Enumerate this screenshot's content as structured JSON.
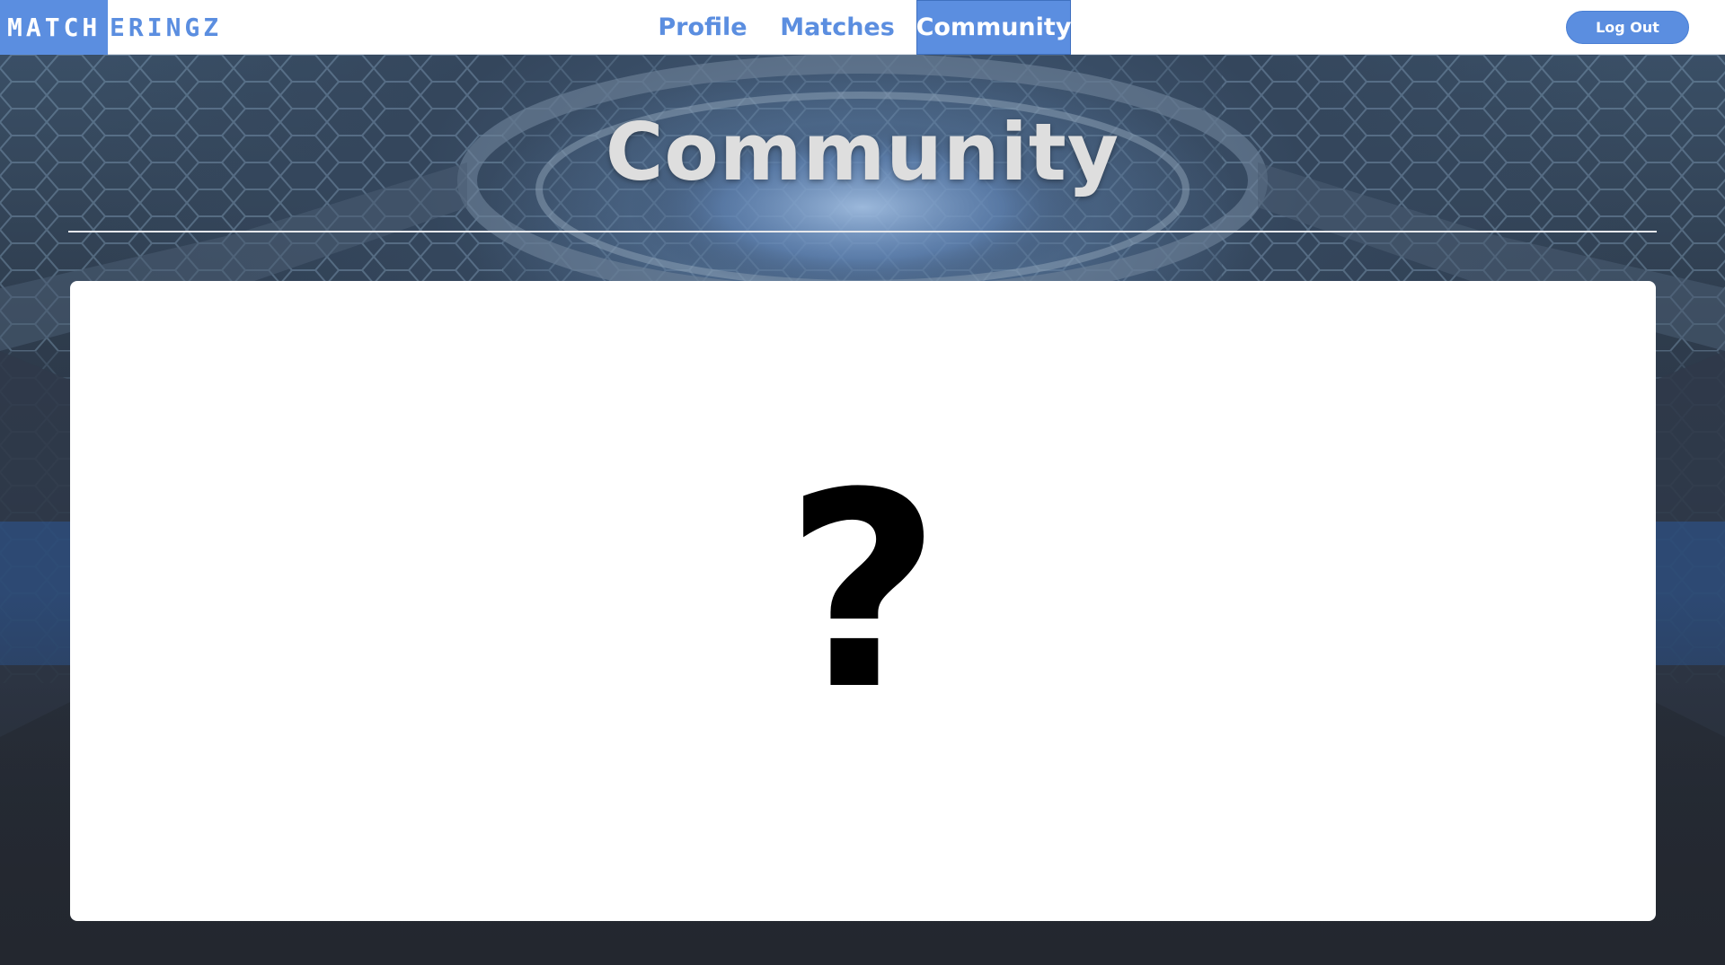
{
  "brand": {
    "part1": "MATCH",
    "part2": "ERINGZ"
  },
  "nav": {
    "links": [
      {
        "label": "Profile",
        "active": false
      },
      {
        "label": "Matches",
        "active": false
      },
      {
        "label": "Community",
        "active": true
      }
    ],
    "logout_label": "Log Out"
  },
  "page": {
    "title": "Community",
    "placeholder": "?"
  },
  "colors": {
    "accent": "#5b8ee0",
    "title": "#dedede",
    "panel": "#ffffff",
    "background_dark": "#23262e"
  }
}
